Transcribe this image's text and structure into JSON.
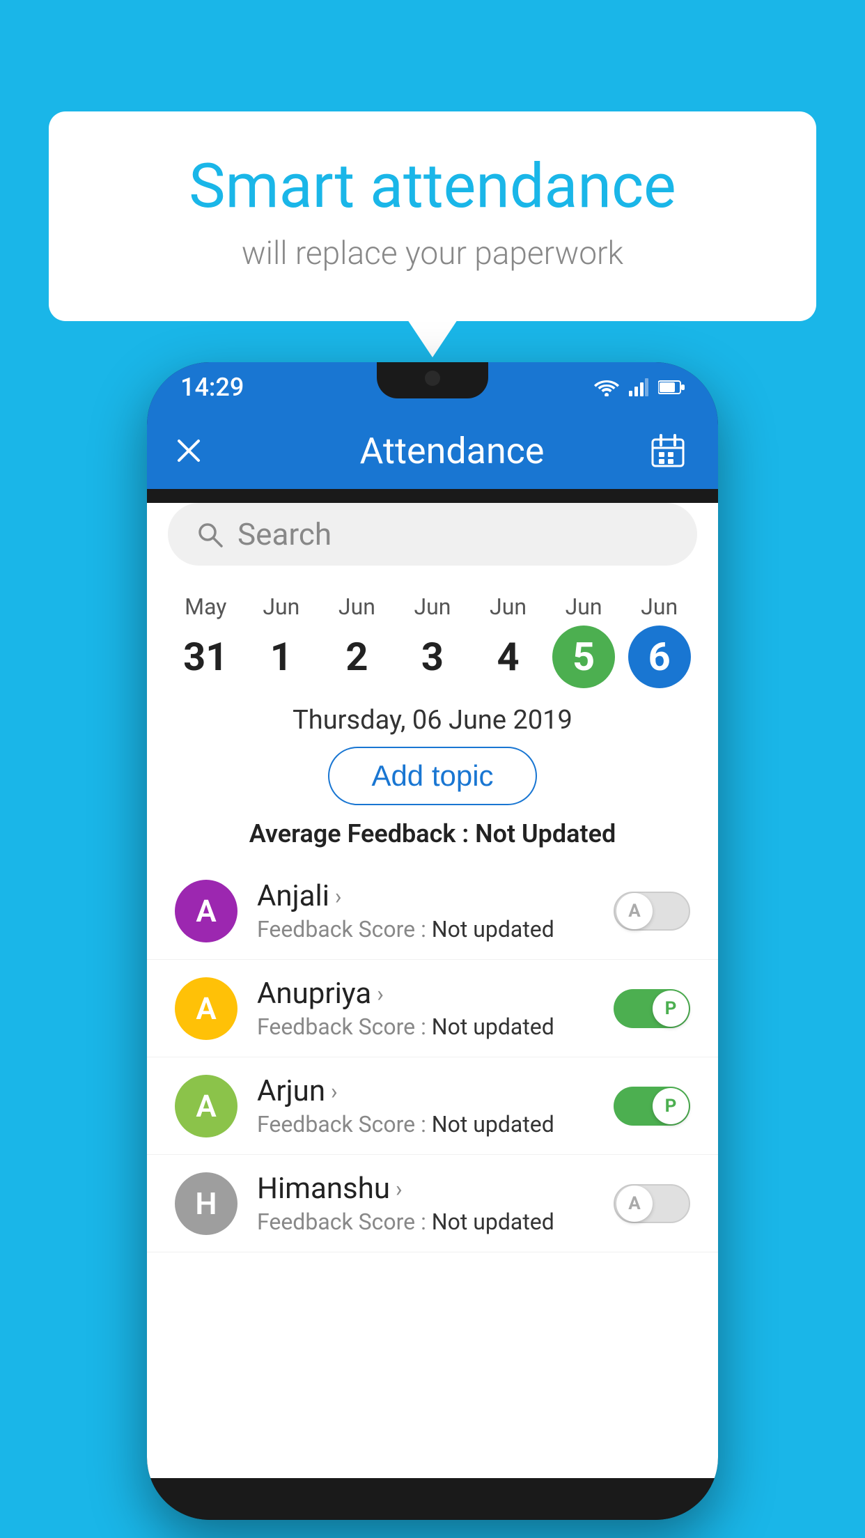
{
  "background_color": "#1ab6e8",
  "speech_bubble": {
    "title": "Smart attendance",
    "subtitle": "will replace your paperwork"
  },
  "status_bar": {
    "time": "14:29",
    "wifi": "wifi",
    "signal": "signal",
    "battery": "battery"
  },
  "app_bar": {
    "close_label": "×",
    "title": "Attendance",
    "calendar_icon": "calendar"
  },
  "search": {
    "placeholder": "Search"
  },
  "calendar": {
    "days": [
      {
        "month": "May",
        "date": "31",
        "style": "normal"
      },
      {
        "month": "Jun",
        "date": "1",
        "style": "normal"
      },
      {
        "month": "Jun",
        "date": "2",
        "style": "normal"
      },
      {
        "month": "Jun",
        "date": "3",
        "style": "normal"
      },
      {
        "month": "Jun",
        "date": "4",
        "style": "normal"
      },
      {
        "month": "Jun",
        "date": "5",
        "style": "green"
      },
      {
        "month": "Jun",
        "date": "6",
        "style": "blue"
      }
    ]
  },
  "selected_date": "Thursday, 06 June 2019",
  "add_topic_label": "Add topic",
  "average_feedback_label": "Average Feedback : ",
  "average_feedback_value": "Not Updated",
  "students": [
    {
      "name": "Anjali",
      "avatar_letter": "A",
      "avatar_color": "#9c27b0",
      "feedback_label": "Feedback Score : ",
      "feedback_value": "Not updated",
      "toggle": "off",
      "toggle_letter": "A"
    },
    {
      "name": "Anupriya",
      "avatar_letter": "A",
      "avatar_color": "#ffc107",
      "feedback_label": "Feedback Score : ",
      "feedback_value": "Not updated",
      "toggle": "on",
      "toggle_letter": "P"
    },
    {
      "name": "Arjun",
      "avatar_letter": "A",
      "avatar_color": "#8bc34a",
      "feedback_label": "Feedback Score : ",
      "feedback_value": "Not updated",
      "toggle": "on",
      "toggle_letter": "P"
    },
    {
      "name": "Himanshu",
      "avatar_letter": "H",
      "avatar_color": "#9e9e9e",
      "feedback_label": "Feedback Score : ",
      "feedback_value": "Not updated",
      "toggle": "off",
      "toggle_letter": "A"
    }
  ]
}
